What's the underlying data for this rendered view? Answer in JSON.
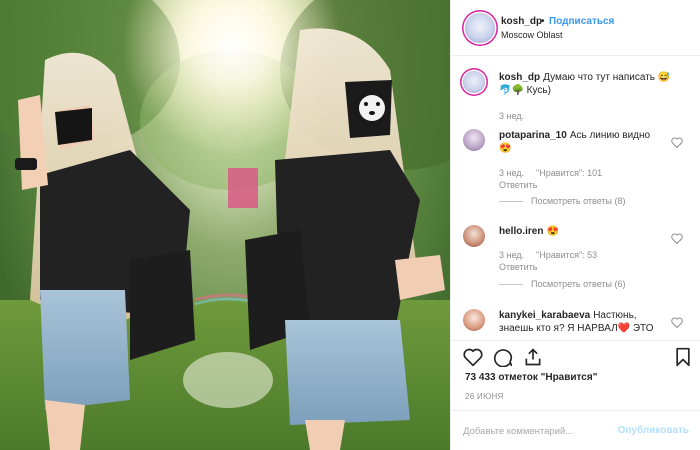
{
  "post": {
    "author": "kosh_dp",
    "separator": "•",
    "follow_label": "Подписаться",
    "location": "Moscow Oblast"
  },
  "caption": {
    "author": "kosh_dp",
    "text": "Думаю что тут написать 😅",
    "text_line2": "🐬🌳 Кусь)",
    "time": "3 нед."
  },
  "comments": [
    {
      "author": "potaparina_10",
      "text": "Ась линию видно",
      "emoji": "😍",
      "time": "3 нед.",
      "likes": "\"Нравится\": 101",
      "reply_label": "Ответить",
      "thread_label": "Посмотреть ответы (8)"
    },
    {
      "author": "hello.iren",
      "text": "😍",
      "time": "3 нед.",
      "likes": "\"Нравится\": 53",
      "reply_label": "Ответить",
      "thread_label": "Посмотреть ответы (6)"
    },
    {
      "author": "kanykei_karabaeva",
      "text": "Настюнь,",
      "text_line2": "знаешь кто я? Я НАРВАЛ❤️ ЭТО"
    }
  ],
  "likes_count": "73 433 отметок \"Нравится\"",
  "date": "26 ИЮНЯ",
  "add_comment": {
    "placeholder": "Добавьте комментарий...",
    "publish_label": "Опубликовать"
  },
  "colors": {
    "accent": "#3897f0",
    "publish_disabled": "#b2dffc",
    "muted": "#8e8e8e",
    "border": "#efefef"
  },
  "icons": [
    "heart-icon",
    "comment-icon",
    "share-icon",
    "bookmark-icon",
    "more-icon"
  ]
}
